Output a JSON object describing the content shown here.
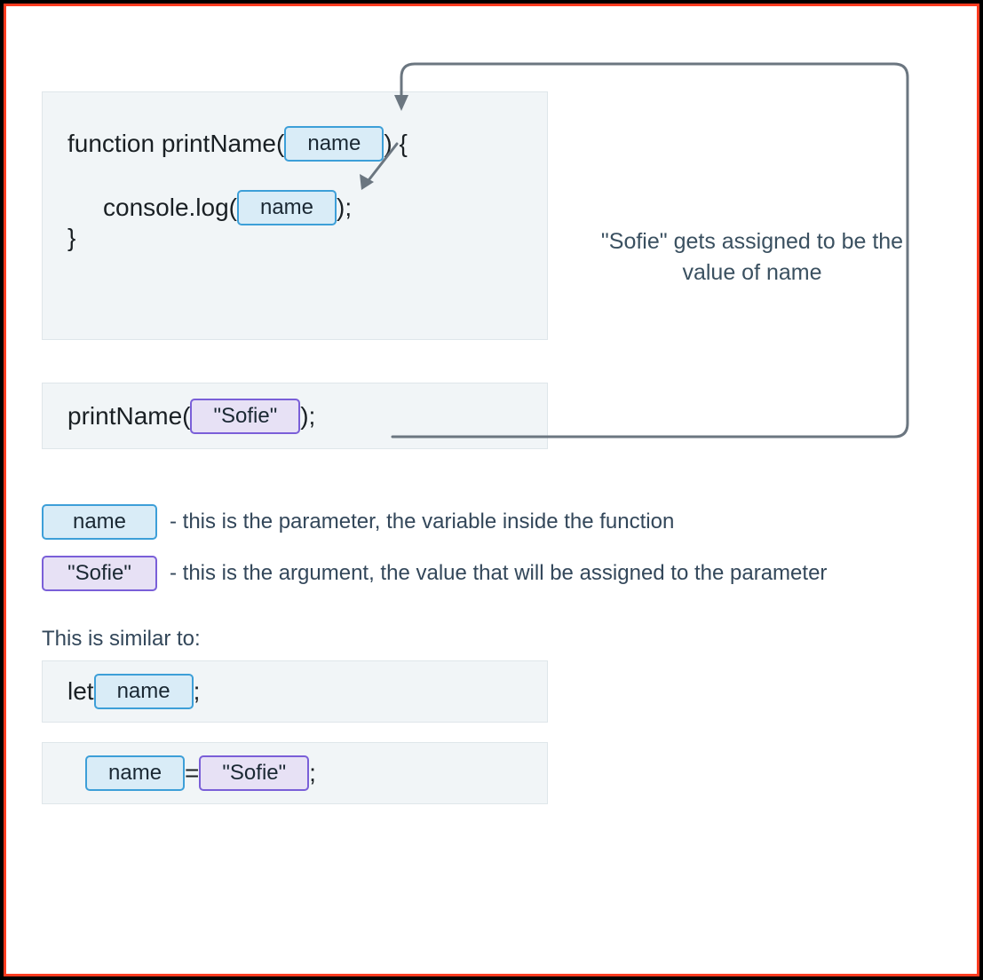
{
  "func": {
    "decl_prefix": "function printName(",
    "decl_suffix": ") {",
    "param": "name",
    "log_prefix": "console.log(",
    "log_param": "name",
    "log_suffix": ");",
    "close_brace": "}"
  },
  "call": {
    "prefix": "printName(",
    "arg": "\"Sofie\"",
    "suffix": ");"
  },
  "annotation": "\"Sofie\" gets assigned to be the value of name",
  "legend": {
    "param_token": "name",
    "param_desc": "- this is the parameter, the variable inside the function",
    "arg_token": "\"Sofie\"",
    "arg_desc": "- this is the argument, the value that will be assigned to the parameter"
  },
  "similar": {
    "label": "This is similar to:",
    "let_prefix": "let ",
    "let_token": "name",
    "let_suffix": ";",
    "assign_token": "name",
    "assign_eq": " = ",
    "assign_val": "\"Sofie\"",
    "assign_suffix": " ;"
  }
}
